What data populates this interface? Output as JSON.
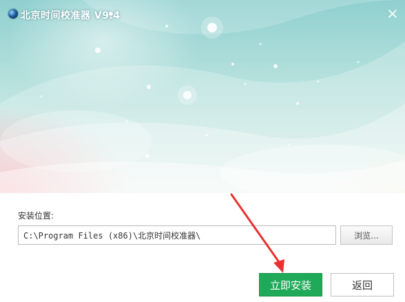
{
  "window": {
    "title": "北京时间校准器 V9.4",
    "close_icon": "close-icon",
    "logo_icon": "globe-icon"
  },
  "install": {
    "location_label": "安装位置:",
    "path_value": "C:\\Program Files (x86)\\北京时间校准器\\",
    "browse_label": "浏览..."
  },
  "actions": {
    "install_label": "立即安装",
    "back_label": "返回"
  },
  "colors": {
    "install_button": "#1faa59",
    "annotation_arrow": "#e8312f"
  }
}
